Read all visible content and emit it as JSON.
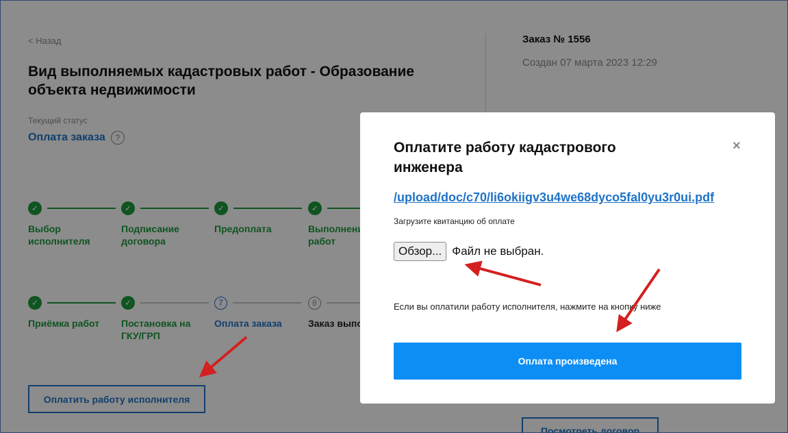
{
  "page": {
    "back_link": "< Назад",
    "title": "Вид выполняемых кадастровых работ - Образование объекта недвижимости",
    "status_caption": "Текущий статус",
    "status_value": "Оплата заказа",
    "help_icon": "?"
  },
  "order": {
    "number": "Заказ № 1556",
    "created": "Создан 07 марта 2023 12:29"
  },
  "steps": [
    {
      "label": "Выбор исполнителя",
      "state": "done"
    },
    {
      "label": "Подписание договора",
      "state": "done"
    },
    {
      "label": "Предоплата",
      "state": "done"
    },
    {
      "label": "Выполнение работ",
      "state": "done"
    },
    {
      "label": "Приёмка работ",
      "state": "done"
    },
    {
      "label": "Постановка на ГКУ/ГРП",
      "state": "done"
    },
    {
      "label": "Оплата заказа",
      "state": "current",
      "number": "7"
    },
    {
      "label": "Заказ выполнен",
      "state": "future",
      "number": "8"
    }
  ],
  "buttons": {
    "pay_executor": "Оплатить работу исполнителя",
    "view_contract": "Посмотреть договор"
  },
  "modal": {
    "title": "Оплатите работу кадастрового инженера",
    "close_symbol": "×",
    "file_link": "/upload/doc/c70/li6okiigv3u4we68dyco5fal0yu3r0ui.pdf",
    "upload_hint": "Загрузите квитанцию об оплате",
    "browse_label": "Обзор...",
    "no_file_text": "Файл не выбран.",
    "note": "Если вы оплатили работу исполнителя, нажмите на кнопку ниже",
    "submit_label": "Оплата произведена"
  },
  "colors": {
    "accent_blue": "#1f73c7",
    "done_green": "#1d9a3c",
    "submit_blue": "#0d8ef5",
    "annotation_red": "#d42020"
  }
}
